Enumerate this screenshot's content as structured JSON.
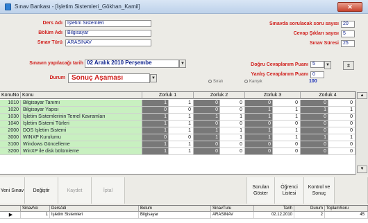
{
  "window": {
    "title": "Sınav Bankası - [İşletim Sistemleri_Gökhan_Kamil]",
    "close_glyph": "✕"
  },
  "form": {
    "ders_adi_label": "Ders Adı",
    "ders_adi_value": "İşletim Sistemleri",
    "bolum_adi_label": "Bölüm Adı",
    "bolum_adi_value": "Bilgisayar",
    "sinav_turu_label": "Sınav Türü",
    "sinav_turu_value": "ARASINAV",
    "tarih_label": "Sınavın yapılacağı tarih",
    "tarih_value": "02 Aralık 2010 Perşembe",
    "durum_label": "Durum",
    "durum_value": "Sonuç Aşaması",
    "soru_sayisi_label": "Sınavda sorulacak soru sayısı",
    "soru_sayisi_value": "20",
    "cevap_sikki_label": "Cevap Şıkları sayısı",
    "cevap_sikki_value": "5",
    "sinav_suresi_label": "Sınav Süresi",
    "sinav_suresi_value": "25",
    "dogru_puan_label": "Doğru Cevaplanım Puanı",
    "dogru_puan_value": "5",
    "yanlis_puan_label": "Yanlış Cevaplanım Puanı",
    "yanlis_puan_value": "0",
    "radio_1": "Sıralı",
    "radio_2": "Karışık",
    "score_value": "100",
    "spin_glyph": "±",
    "arrow_glyph": "▼"
  },
  "grid": {
    "headers": [
      "KonuNo",
      "Konu",
      "Zorluk 1",
      "Zorluk 2",
      "Zorluk 3",
      "Zorluk 4"
    ],
    "rows": [
      {
        "code": "1010",
        "name": "Bilgisayar Tanımı",
        "z1d": "1",
        "z1": "1",
        "z2d": "0",
        "z2": "0",
        "z3d": "0",
        "z3": "0",
        "z4d": "0",
        "z4": "0"
      },
      {
        "code": "1020",
        "name": "Bilgisayar Yapısı",
        "z1d": "0",
        "z1": "0",
        "z2d": "0",
        "z2": "0",
        "z3d": "1",
        "z3": "1",
        "z4d": "1",
        "z4": "1"
      },
      {
        "code": "1030",
        "name": "İşletim Sistemlerinin Temel Kavramları",
        "z1d": "1",
        "z1": "1",
        "z2d": "1",
        "z2": "1",
        "z3d": "1",
        "z3": "1",
        "z4d": "0",
        "z4": "0"
      },
      {
        "code": "1040",
        "name": "İşletim Sistemi Türleri",
        "z1d": "1",
        "z1": "1",
        "z2d": "0",
        "z2": "0",
        "z3d": "0",
        "z3": "0",
        "z4d": "0",
        "z4": "0"
      },
      {
        "code": "2000",
        "name": "DOS İşletim Sistemi",
        "z1d": "1",
        "z1": "1",
        "z2d": "1",
        "z2": "1",
        "z3d": "1",
        "z3": "1",
        "z4d": "0",
        "z4": "0"
      },
      {
        "code": "3000",
        "name": "WINXP Kurulumu",
        "z1d": "0",
        "z1": "0",
        "z2d": "1",
        "z2": "1",
        "z3d": "1",
        "z3": "1",
        "z4d": "1",
        "z4": "1"
      },
      {
        "code": "3100",
        "name": "Windows Güncelleme",
        "z1d": "1",
        "z1": "1",
        "z2d": "0",
        "z2": "0",
        "z3d": "0",
        "z3": "0",
        "z4d": "0",
        "z4": "0"
      },
      {
        "code": "3200",
        "name": "WinXP ile disk bölümleme",
        "z1d": "1",
        "z1": "1",
        "z2d": "0",
        "z2": "0",
        "z3d": "0",
        "z3": "0",
        "z4d": "0",
        "z4": "0"
      }
    ],
    "scroll_up": "▲",
    "scroll_down": "▼"
  },
  "toolbar": {
    "yeni": "Yeni Sınav",
    "degistir": "Değiştir",
    "kaydet": "Kaydet",
    "iptal": "İptal",
    "sorulan": "Sorulan Göster",
    "ogrenci": "Öğrenci Listesi",
    "kontrol": "Kontrol ve Sonuç"
  },
  "bottom_grid": {
    "headers": [
      "SinavNo",
      "DersAdi",
      "Bolum",
      "SinavTuru",
      "Tarih",
      "Durum",
      "ToplamSoru"
    ],
    "row_pointer": "▶",
    "row": [
      "1",
      "İşletim Sistemleri",
      "Bilgisayar",
      "ARASINAV",
      "02.12.2010",
      "2",
      "45"
    ]
  }
}
